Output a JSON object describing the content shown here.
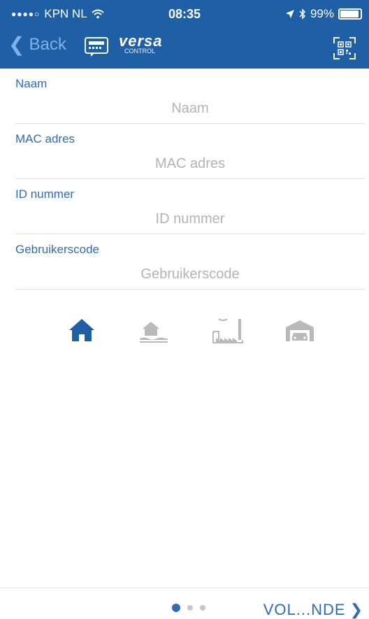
{
  "status_bar": {
    "signal_dots": "●●●●○",
    "carrier": "KPN NL",
    "time": "08:35",
    "battery": "99%"
  },
  "nav": {
    "back_label": "Back",
    "logo_brand": "versa",
    "logo_sub": "CONTROL"
  },
  "form": {
    "fields": [
      {
        "label": "Naam",
        "value": "",
        "placeholder": "Naam"
      },
      {
        "label": "MAC adres",
        "value": "",
        "placeholder": "MAC adres"
      },
      {
        "label": "ID nummer",
        "value": "",
        "placeholder": "ID nummer"
      },
      {
        "label": "Gebruikerscode",
        "value": "",
        "placeholder": "Gebruikerscode"
      }
    ]
  },
  "location_types": [
    {
      "icon": "house-icon",
      "selected": true
    },
    {
      "icon": "house-water-icon",
      "selected": false
    },
    {
      "icon": "factory-icon",
      "selected": false
    },
    {
      "icon": "garage-icon",
      "selected": false
    }
  ],
  "pager": {
    "total": 3,
    "active": 1
  },
  "footer": {
    "next_label": "VOL...NDE"
  },
  "colors": {
    "header_bg": "#1f5fa6",
    "accent": "#2e6db2",
    "back_text": "#7fb1ea",
    "inactive_icon": "#b9b9b9"
  }
}
